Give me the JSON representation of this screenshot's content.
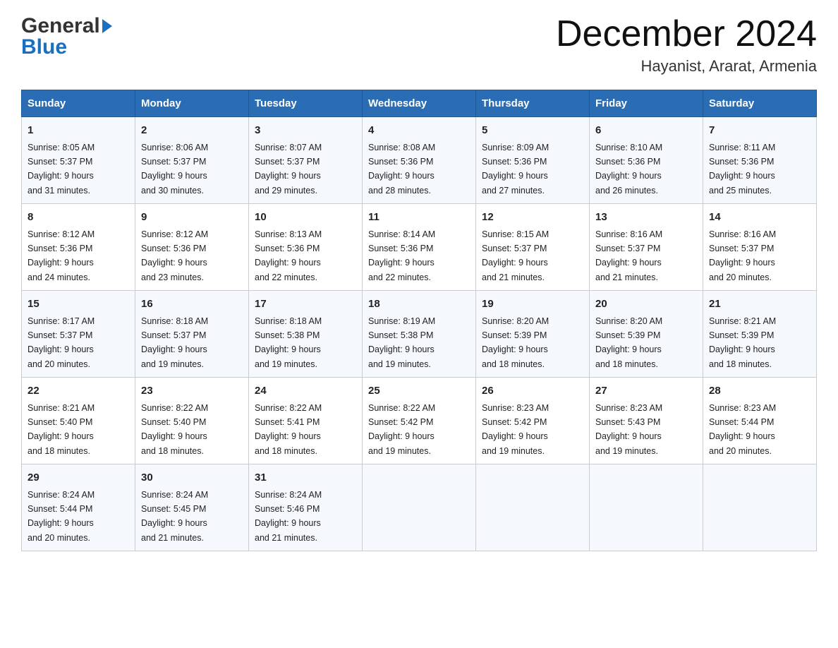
{
  "header": {
    "logo_line1": "General",
    "logo_line2": "Blue",
    "month_title": "December 2024",
    "location": "Hayanist, Ararat, Armenia"
  },
  "days_of_week": [
    "Sunday",
    "Monday",
    "Tuesday",
    "Wednesday",
    "Thursday",
    "Friday",
    "Saturday"
  ],
  "weeks": [
    [
      {
        "day": "1",
        "sunrise": "8:05 AM",
        "sunset": "5:37 PM",
        "daylight": "9 hours and 31 minutes."
      },
      {
        "day": "2",
        "sunrise": "8:06 AM",
        "sunset": "5:37 PM",
        "daylight": "9 hours and 30 minutes."
      },
      {
        "day": "3",
        "sunrise": "8:07 AM",
        "sunset": "5:37 PM",
        "daylight": "9 hours and 29 minutes."
      },
      {
        "day": "4",
        "sunrise": "8:08 AM",
        "sunset": "5:36 PM",
        "daylight": "9 hours and 28 minutes."
      },
      {
        "day": "5",
        "sunrise": "8:09 AM",
        "sunset": "5:36 PM",
        "daylight": "9 hours and 27 minutes."
      },
      {
        "day": "6",
        "sunrise": "8:10 AM",
        "sunset": "5:36 PM",
        "daylight": "9 hours and 26 minutes."
      },
      {
        "day": "7",
        "sunrise": "8:11 AM",
        "sunset": "5:36 PM",
        "daylight": "9 hours and 25 minutes."
      }
    ],
    [
      {
        "day": "8",
        "sunrise": "8:12 AM",
        "sunset": "5:36 PM",
        "daylight": "9 hours and 24 minutes."
      },
      {
        "day": "9",
        "sunrise": "8:12 AM",
        "sunset": "5:36 PM",
        "daylight": "9 hours and 23 minutes."
      },
      {
        "day": "10",
        "sunrise": "8:13 AM",
        "sunset": "5:36 PM",
        "daylight": "9 hours and 22 minutes."
      },
      {
        "day": "11",
        "sunrise": "8:14 AM",
        "sunset": "5:36 PM",
        "daylight": "9 hours and 22 minutes."
      },
      {
        "day": "12",
        "sunrise": "8:15 AM",
        "sunset": "5:37 PM",
        "daylight": "9 hours and 21 minutes."
      },
      {
        "day": "13",
        "sunrise": "8:16 AM",
        "sunset": "5:37 PM",
        "daylight": "9 hours and 21 minutes."
      },
      {
        "day": "14",
        "sunrise": "8:16 AM",
        "sunset": "5:37 PM",
        "daylight": "9 hours and 20 minutes."
      }
    ],
    [
      {
        "day": "15",
        "sunrise": "8:17 AM",
        "sunset": "5:37 PM",
        "daylight": "9 hours and 20 minutes."
      },
      {
        "day": "16",
        "sunrise": "8:18 AM",
        "sunset": "5:37 PM",
        "daylight": "9 hours and 19 minutes."
      },
      {
        "day": "17",
        "sunrise": "8:18 AM",
        "sunset": "5:38 PM",
        "daylight": "9 hours and 19 minutes."
      },
      {
        "day": "18",
        "sunrise": "8:19 AM",
        "sunset": "5:38 PM",
        "daylight": "9 hours and 19 minutes."
      },
      {
        "day": "19",
        "sunrise": "8:20 AM",
        "sunset": "5:39 PM",
        "daylight": "9 hours and 18 minutes."
      },
      {
        "day": "20",
        "sunrise": "8:20 AM",
        "sunset": "5:39 PM",
        "daylight": "9 hours and 18 minutes."
      },
      {
        "day": "21",
        "sunrise": "8:21 AM",
        "sunset": "5:39 PM",
        "daylight": "9 hours and 18 minutes."
      }
    ],
    [
      {
        "day": "22",
        "sunrise": "8:21 AM",
        "sunset": "5:40 PM",
        "daylight": "9 hours and 18 minutes."
      },
      {
        "day": "23",
        "sunrise": "8:22 AM",
        "sunset": "5:40 PM",
        "daylight": "9 hours and 18 minutes."
      },
      {
        "day": "24",
        "sunrise": "8:22 AM",
        "sunset": "5:41 PM",
        "daylight": "9 hours and 18 minutes."
      },
      {
        "day": "25",
        "sunrise": "8:22 AM",
        "sunset": "5:42 PM",
        "daylight": "9 hours and 19 minutes."
      },
      {
        "day": "26",
        "sunrise": "8:23 AM",
        "sunset": "5:42 PM",
        "daylight": "9 hours and 19 minutes."
      },
      {
        "day": "27",
        "sunrise": "8:23 AM",
        "sunset": "5:43 PM",
        "daylight": "9 hours and 19 minutes."
      },
      {
        "day": "28",
        "sunrise": "8:23 AM",
        "sunset": "5:44 PM",
        "daylight": "9 hours and 20 minutes."
      }
    ],
    [
      {
        "day": "29",
        "sunrise": "8:24 AM",
        "sunset": "5:44 PM",
        "daylight": "9 hours and 20 minutes."
      },
      {
        "day": "30",
        "sunrise": "8:24 AM",
        "sunset": "5:45 PM",
        "daylight": "9 hours and 21 minutes."
      },
      {
        "day": "31",
        "sunrise": "8:24 AM",
        "sunset": "5:46 PM",
        "daylight": "9 hours and 21 minutes."
      },
      null,
      null,
      null,
      null
    ]
  ],
  "labels": {
    "sunrise": "Sunrise:",
    "sunset": "Sunset:",
    "daylight": "Daylight:"
  }
}
